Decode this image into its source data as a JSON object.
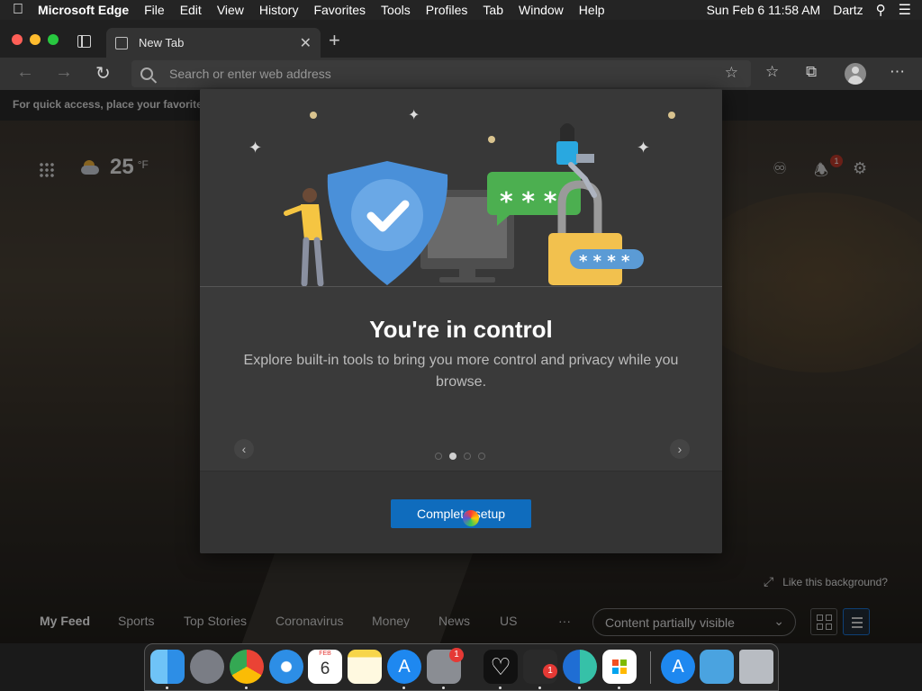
{
  "menubar": {
    "app_name": "Microsoft Edge",
    "items": [
      "File",
      "Edit",
      "View",
      "History",
      "Favorites",
      "Tools",
      "Profiles",
      "Tab",
      "Window",
      "Help"
    ],
    "clock": "Sun Feb 6  11:58 AM",
    "user": "Dartz"
  },
  "tab": {
    "title": "New Tab"
  },
  "address": {
    "placeholder": "Search or enter web address"
  },
  "favorites_bar": {
    "text": "For quick access, place your favorite"
  },
  "newtab_page": {
    "temperature": "25",
    "temp_unit": "°F",
    "notification_count": "1",
    "like_background": "Like this background?",
    "feed_tabs": [
      "My Feed",
      "Sports",
      "Top Stories",
      "Coronavirus",
      "Money",
      "News",
      "US"
    ],
    "more": "···",
    "content_visibility": "Content partially visible"
  },
  "modal": {
    "heading": "You're in control",
    "description": "Explore built-in tools to bring you more control and privacy while you browse.",
    "carousel_prev": "‹",
    "carousel_next": "›",
    "pages_total": 4,
    "current_page": 2,
    "primary_button": "Complete setup"
  },
  "dock": {
    "apps": [
      "Finder",
      "Launchpad",
      "Google Chrome",
      "Safari",
      "Calendar",
      "Notes",
      "App Store",
      "System Preferences",
      "Heart App",
      "Activity App",
      "Microsoft Edge",
      "Microsoft Store",
      "App Store",
      "Downloads",
      "Trash"
    ],
    "calendar_month": "FEB",
    "calendar_day": "6",
    "badge_count": "1"
  },
  "colors": {
    "accent": "#0f6cbd",
    "badge": "#e53935"
  }
}
